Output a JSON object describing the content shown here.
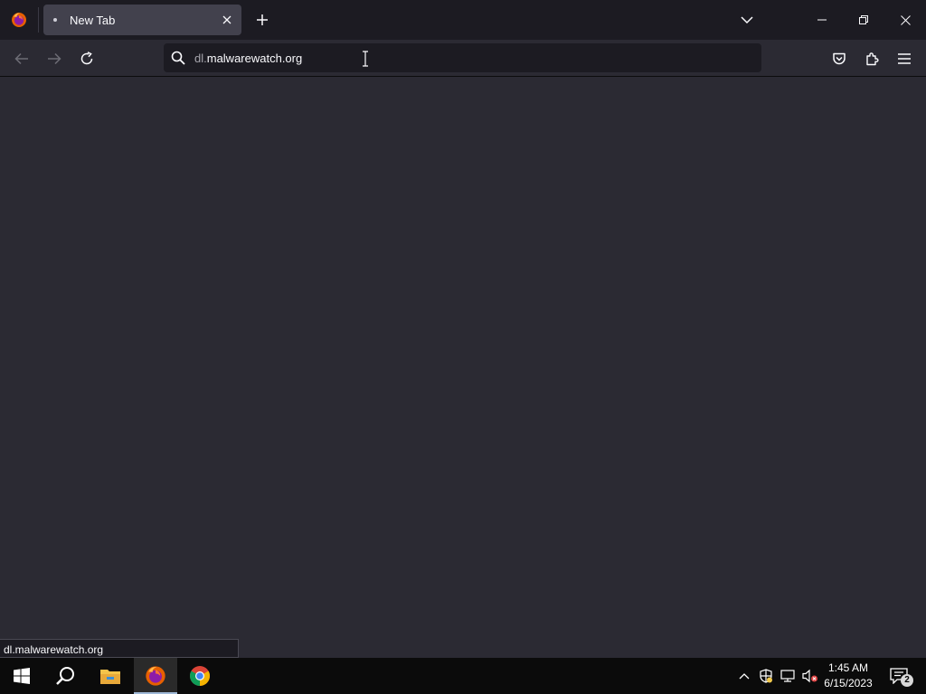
{
  "colors": {
    "tabstrip_bg": "#1c1b22",
    "toolbar_bg": "#2b2a33",
    "selected_tab_bg": "#42414d",
    "urlbar_bg": "#1c1b22",
    "taskbar_bg": "#0b0b0b",
    "text": "#fbfbfe"
  },
  "browser": {
    "app_icon": "firefox-icon",
    "tab": {
      "title": "New Tab",
      "close_icon": "close-icon"
    },
    "new_tab_icon": "plus-icon",
    "tab_list_icon": "chevron-down-icon",
    "window_controls": [
      "minimize-icon",
      "restore-icon",
      "close-icon"
    ]
  },
  "navbar": {
    "back_icon": "arrow-left-icon",
    "forward_icon": "arrow-right-icon",
    "reload_icon": "reload-icon",
    "url": {
      "prefix": "dl.",
      "domain": "malwarewatch.org"
    },
    "toolbar_icons": [
      "pocket-icon",
      "extensions-icon",
      "hamburger-menu-icon"
    ]
  },
  "status": {
    "text": "dl.malwarewatch.org"
  },
  "taskbar": {
    "apps": [
      "windows-start-icon",
      "search-icon",
      "file-explorer-icon",
      "firefox-icon",
      "chrome-icon"
    ],
    "tray_icons": [
      "chevron-up-icon",
      "security-shield-icon",
      "network-icon",
      "volume-muted-icon"
    ],
    "clock": {
      "time": "1:45 AM",
      "date": "6/15/2023"
    },
    "notifications": {
      "count": "2"
    }
  }
}
